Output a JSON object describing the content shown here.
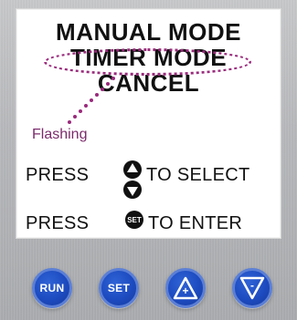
{
  "display": {
    "lines": [
      "MANUAL MODE",
      "TIMER MODE",
      "CANCEL"
    ],
    "flashing_note": "Flashing",
    "instructions": {
      "press1": "PRESS",
      "select_text": "TO SELECT",
      "press2": "PRESS",
      "enter_text": "TO ENTER"
    },
    "mini_icons": {
      "updown": "up-down-arrows-icon",
      "set": "set-button-icon"
    },
    "set_icon_text": "SET"
  },
  "buttons": [
    {
      "id": "run",
      "label": "RUN"
    },
    {
      "id": "set",
      "label": "SET"
    },
    {
      "id": "up",
      "label": "+"
    },
    {
      "id": "down",
      "label": "-"
    }
  ],
  "colors": {
    "panel": "#b9babc",
    "button_blue": "#1d4bc0",
    "button_ring": "#5b7fd6",
    "highlight": "#9a2a7c",
    "flash_label": "#7b2b6c",
    "text": "#111111"
  }
}
